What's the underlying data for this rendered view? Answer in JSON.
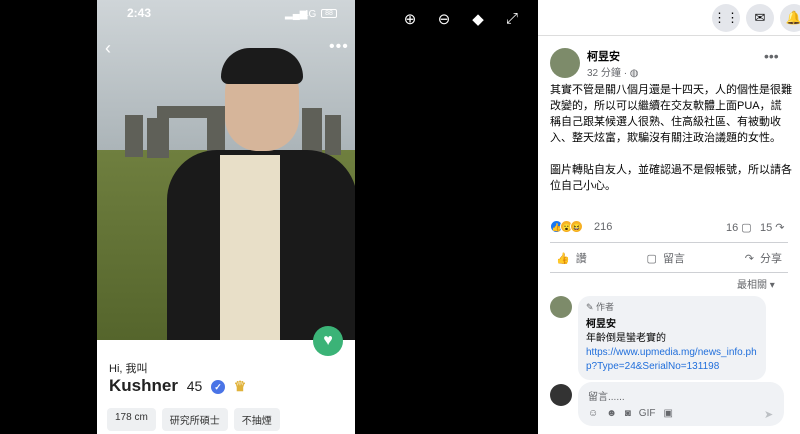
{
  "phone": {
    "time": "2:43",
    "network": "4G",
    "battery": "88",
    "greeting": "Hi, 我叫",
    "name": "Kushner",
    "age": "45",
    "tags": [
      "178 cm",
      "研究所碩士",
      "不抽煙"
    ]
  },
  "post": {
    "author": "柯昱安",
    "time": "32 分鐘",
    "body_p1": "其實不管是關八個月還是十四天，人的個性是很難改變的，所以可以繼續在交友軟體上面PUA，謊稱自己跟某候選人很熟、住高級社區、有被動收入、整天炫富，欺騙沒有關注政治議題的女性。",
    "body_p2": "圖片轉貼自友人，並確認過不是假帳號，所以請各位自己小心。",
    "reactions": "216",
    "comments": "16",
    "shares": "15",
    "action_like": "讚",
    "action_comment": "留言",
    "action_share": "分享",
    "sort_label": "最相關",
    "comment": {
      "badge": "作者",
      "name": "柯昱安",
      "text": "年齡倒是蠻老實的",
      "link": "https://www.upmedia.mg/news_info.php?Type=24&SerialNo=131198"
    },
    "compose_placeholder": "留言......"
  },
  "colors": {
    "link": "#216fdb",
    "like": "#1877f2",
    "heart_button": "#3bb377"
  }
}
